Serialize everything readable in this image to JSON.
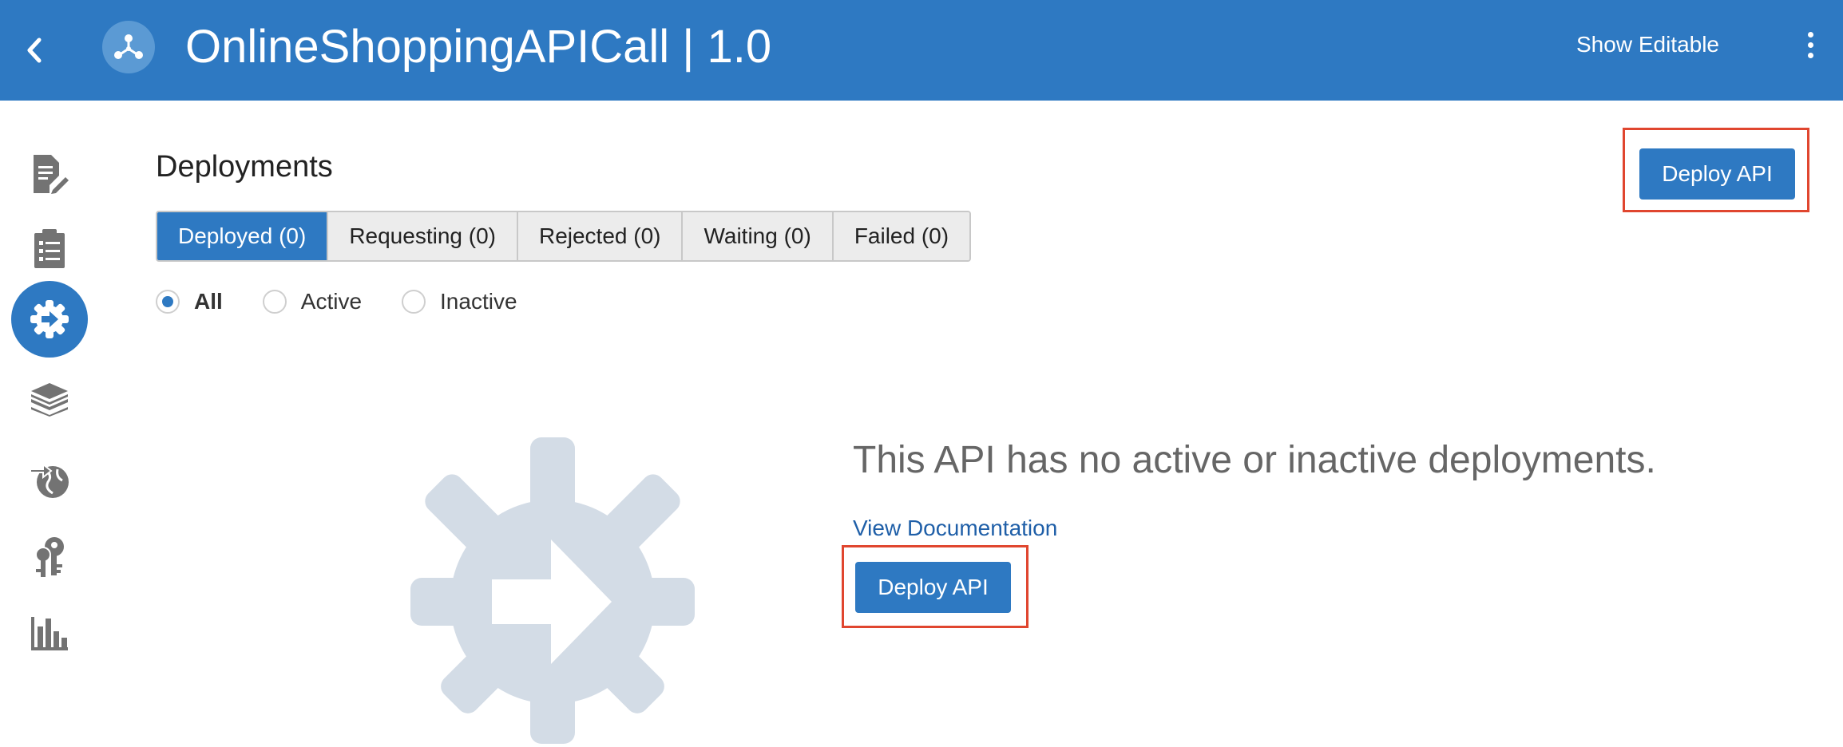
{
  "header": {
    "title": "OnlineShoppingAPICall | 1.0",
    "show_editable": "Show Editable",
    "icons": [
      "chevron-left-icon",
      "api-logo-icon",
      "kebab-menu-icon"
    ]
  },
  "sidebar": {
    "items": [
      {
        "name": "edit-document-icon",
        "active": false
      },
      {
        "name": "checklist-icon",
        "active": false
      },
      {
        "name": "deployments-gear-icon",
        "active": true
      },
      {
        "name": "layers-icon",
        "active": false
      },
      {
        "name": "globe-publish-icon",
        "active": false
      },
      {
        "name": "keys-icon",
        "active": false
      },
      {
        "name": "analytics-bar-chart-icon",
        "active": false
      }
    ]
  },
  "main": {
    "heading": "Deployments",
    "tabs": [
      {
        "label": "Deployed (0)",
        "active": true
      },
      {
        "label": "Requesting (0)",
        "active": false
      },
      {
        "label": "Rejected (0)",
        "active": false
      },
      {
        "label": "Waiting (0)",
        "active": false
      },
      {
        "label": "Failed (0)",
        "active": false
      }
    ],
    "filters": [
      {
        "label": "All",
        "checked": true
      },
      {
        "label": "Active",
        "checked": false
      },
      {
        "label": "Inactive",
        "checked": false
      }
    ],
    "deploy_top_label": "Deploy API",
    "empty_message": "This API has no active or inactive deployments.",
    "view_documentation": "View Documentation",
    "deploy_main_label": "Deploy API"
  },
  "colors": {
    "accent": "#2e79c2",
    "highlight": "#e0462f",
    "link": "#1f5fa8",
    "illustration": "#d3dce6"
  }
}
